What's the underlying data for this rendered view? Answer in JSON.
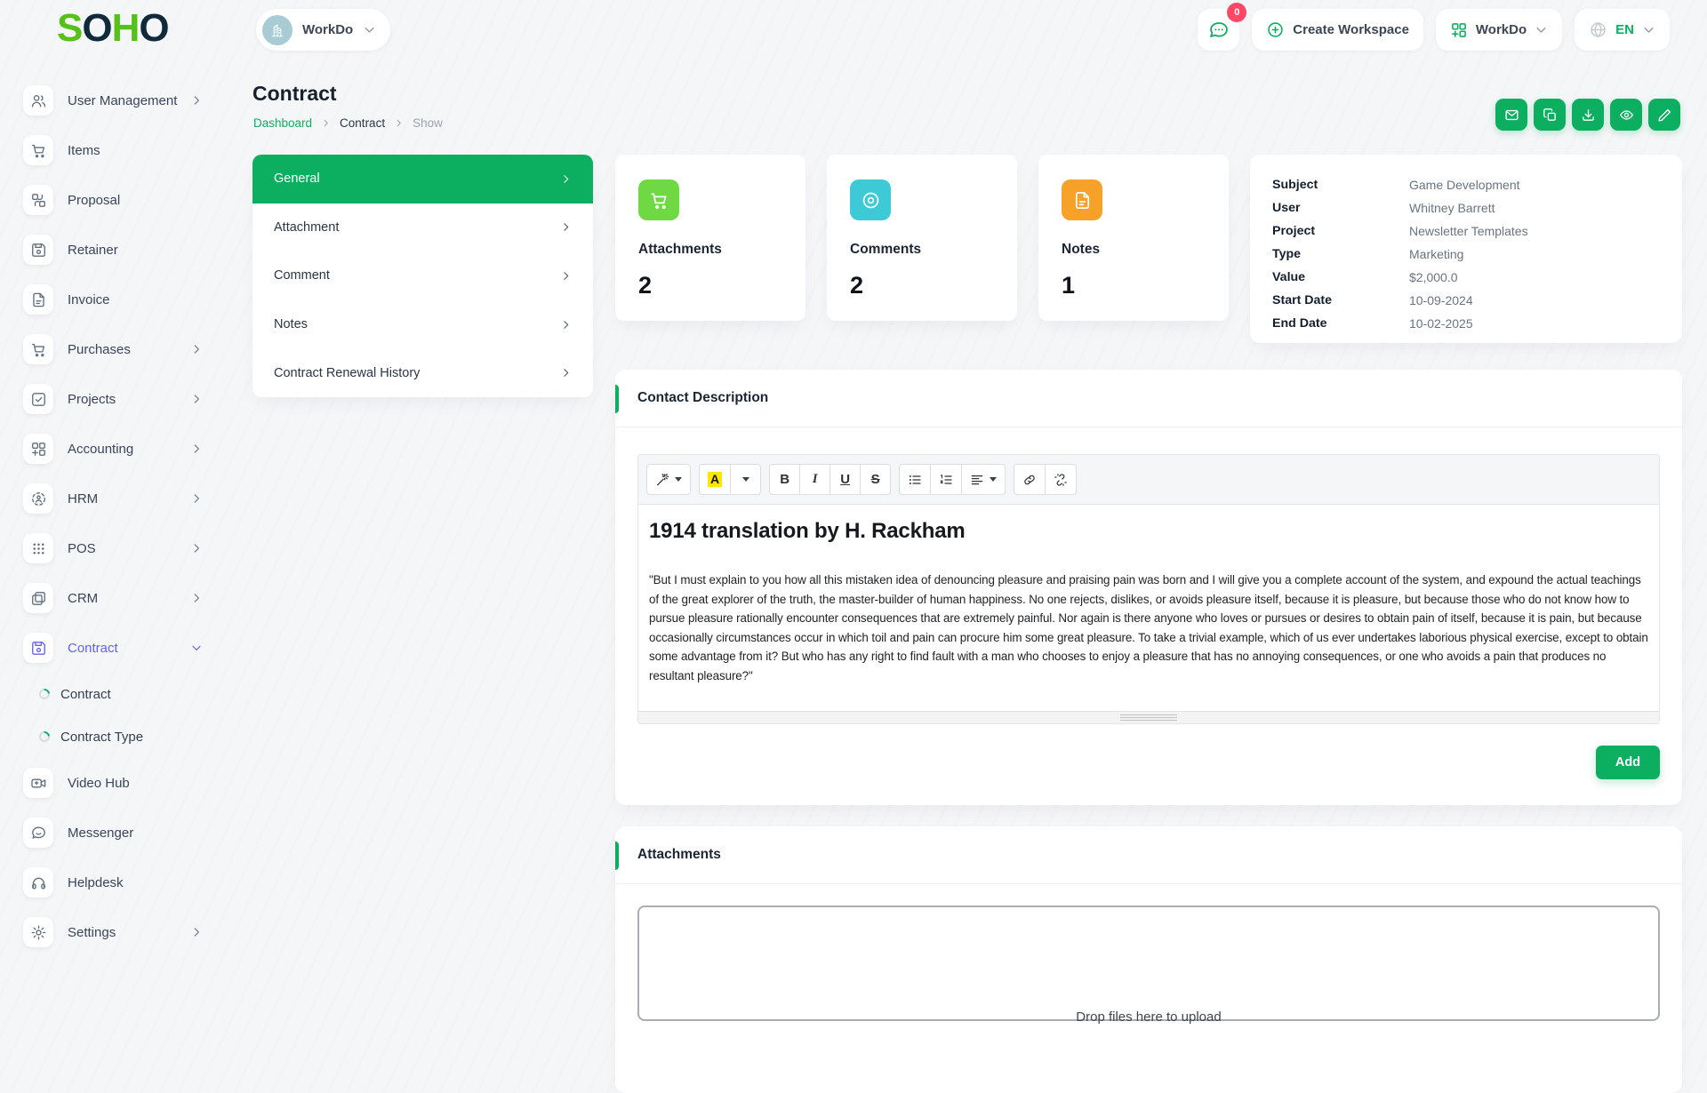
{
  "theme": {
    "primary": "#0caf60",
    "secondary": "#6560f0",
    "logo_green": "#56c118",
    "logo_dark": "#102a3c",
    "stat_green": "#6fd943",
    "stat_cyan": "#3ec9d6",
    "stat_orange": "#f8a128",
    "badge": "#ff4766"
  },
  "brand": {
    "letters": [
      "S",
      "O",
      "H",
      "O"
    ]
  },
  "header": {
    "workspace_switcher": "WorkDo",
    "chat_badge": "0",
    "create_workspace": "Create Workspace",
    "apps_menu": "WorkDo",
    "language": "EN"
  },
  "sidebar": {
    "items": [
      {
        "label": "User Management",
        "icon": "users",
        "chevron": "right"
      },
      {
        "label": "Items",
        "icon": "cart"
      },
      {
        "label": "Proposal",
        "icon": "swap"
      },
      {
        "label": "Retainer",
        "icon": "save"
      },
      {
        "label": "Invoice",
        "icon": "file-text"
      },
      {
        "label": "Purchases",
        "icon": "cart",
        "chevron": "right"
      },
      {
        "label": "Projects",
        "icon": "check-square",
        "chevron": "right"
      },
      {
        "label": "Accounting",
        "icon": "grid-plus",
        "chevron": "right"
      },
      {
        "label": "HRM",
        "icon": "hrm",
        "chevron": "right"
      },
      {
        "label": "POS",
        "icon": "pos-grid",
        "chevron": "right"
      },
      {
        "label": "CRM",
        "icon": "crm",
        "chevron": "right"
      },
      {
        "label": "Contract",
        "icon": "save",
        "chevron": "down",
        "active": true
      },
      {
        "label": "Contract",
        "sub": true
      },
      {
        "label": "Contract Type",
        "sub": true
      },
      {
        "label": "Video Hub",
        "icon": "video"
      },
      {
        "label": "Messenger",
        "icon": "message"
      },
      {
        "label": "Helpdesk",
        "icon": "headphones"
      },
      {
        "label": "Settings",
        "icon": "gear",
        "chevron": "right"
      }
    ]
  },
  "page": {
    "title": "Contract",
    "breadcrumb": [
      "Dashboard",
      "Contract",
      "Show"
    ]
  },
  "toolbar_actions": [
    {
      "name": "mail",
      "icon": "mail"
    },
    {
      "name": "duplicate",
      "icon": "copy"
    },
    {
      "name": "download",
      "icon": "download"
    },
    {
      "name": "preview",
      "icon": "eye"
    },
    {
      "name": "edit",
      "icon": "pencil"
    }
  ],
  "tabs": {
    "active": "General",
    "items": [
      "General",
      "Attachment",
      "Comment",
      "Notes",
      "Contract Renewal History"
    ]
  },
  "stats": {
    "cards": [
      {
        "label": "Attachments",
        "value": "2",
        "icon": "cart",
        "color": "#6fd943"
      },
      {
        "label": "Comments",
        "value": "2",
        "icon": "stat-eye",
        "color": "#3ec9d6"
      },
      {
        "label": "Notes",
        "value": "1",
        "icon": "file-text",
        "color": "#f8a128"
      }
    ]
  },
  "details": {
    "rows": [
      {
        "label": "Subject",
        "value": "Game Development"
      },
      {
        "label": "User",
        "value": "Whitney Barrett"
      },
      {
        "label": "Project",
        "value": "Newsletter Templates"
      },
      {
        "label": "Type",
        "value": "Marketing"
      },
      {
        "label": "Value",
        "value": "$2,000.0"
      },
      {
        "label": "Start Date",
        "value": "10-09-2024"
      },
      {
        "label": "End Date",
        "value": "10-02-2025"
      }
    ]
  },
  "description": {
    "title": "Contact Description",
    "heading": "1914 translation by H. Rackham",
    "body": "\"But I must explain to you how all this mistaken idea of denouncing pleasure and praising pain was born and I will give you a complete account of the system, and expound the actual teachings of the great explorer of the truth, the master-builder of human happiness. No one rejects, dislikes, or avoids pleasure itself, because it is pleasure, but because those who do not know how to pursue pleasure rationally encounter consequences that are extremely painful. Nor again is there anyone who loves or pursues or desires to obtain pain of itself, because it is pain, but because occasionally circumstances occur in which toil and pain can procure him some great pleasure. To take a trivial example, which of us ever undertakes laborious physical exercise, except to obtain some advantage from it? But who has any right to find fault with a man who chooses to enjoy a pleasure that has no annoying consequences, or one who avoids a pain that produces no resultant pleasure?\"",
    "add_button": "Add",
    "editor_toolbar": [
      [
        {
          "icon": "magic",
          "caret": true
        }
      ],
      [
        {
          "icon": "font-color"
        },
        {
          "icon": "caret-only"
        }
      ],
      [
        {
          "icon": "bold"
        },
        {
          "icon": "italic"
        },
        {
          "icon": "underline"
        },
        {
          "icon": "strikethrough"
        }
      ],
      [
        {
          "icon": "list-ul"
        },
        {
          "icon": "list-ol"
        },
        {
          "icon": "align",
          "caret": true
        }
      ],
      [
        {
          "icon": "link"
        },
        {
          "icon": "unlink"
        }
      ]
    ]
  },
  "attachments": {
    "title": "Attachments",
    "dropzone": "Drop files here to upload"
  }
}
